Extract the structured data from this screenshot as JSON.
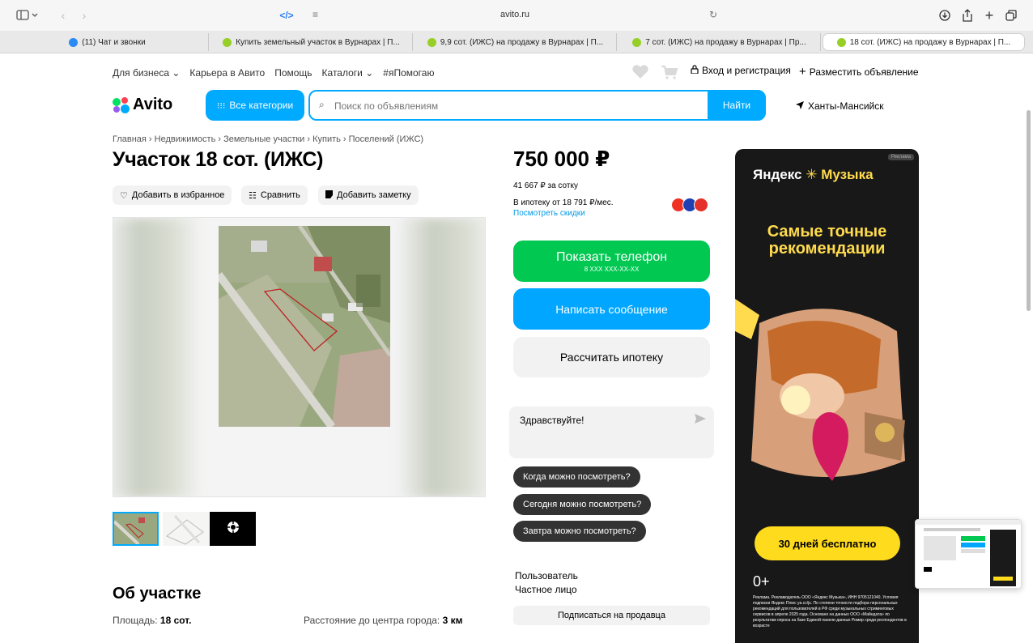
{
  "browser": {
    "url": "avito.ru",
    "tabs": [
      {
        "title": "(11) Чат и звонки",
        "color": "#2a8af6"
      },
      {
        "title": "Купить земельный участок в Вурнарах | П...",
        "color": "#97cf26"
      },
      {
        "title": "9,9 сот. (ИЖС) на продажу в Вурнарах | П...",
        "color": "#97cf26"
      },
      {
        "title": "7 сот. (ИЖС) на продажу в Вурнарах | Пр...",
        "color": "#97cf26"
      },
      {
        "title": "18 сот. (ИЖС) на продажу в Вурнарах | П...",
        "color": "#97cf26"
      }
    ]
  },
  "topnav": {
    "items": [
      "Для бизнеса ⌄",
      "Карьера в Авито",
      "Помощь",
      "Каталоги ⌄",
      "#яПомогаю"
    ],
    "login": "Вход и регистрация",
    "post_ad": "Разместить объявление"
  },
  "header": {
    "logo": "Avito",
    "categories_button": "Все категории",
    "search_placeholder": "Поиск по объявлениям",
    "find_button": "Найти",
    "city": "Ханты-Мансийск"
  },
  "breadcrumbs": "Главная › Недвижимость › Земельные участки › Купить › Поселений (ИЖС)",
  "listing": {
    "title": "Участок 18 сот. (ИЖС)",
    "actions": {
      "favorite": "Добавить в избранное",
      "compare": "Сравнить",
      "note": "Добавить заметку"
    },
    "about_heading": "Об участке",
    "params": [
      {
        "label": "Площадь:",
        "value": "18 сот."
      },
      {
        "label": "Расстояние до центра города:",
        "value": "3 км"
      }
    ]
  },
  "sidebar": {
    "price": "750 000 ₽",
    "per_sotka": "41 667 ₽ за сотку",
    "mortgage": "В ипотеку от 18 791 ₽/мес.",
    "discounts_link": "Посмотреть скидки",
    "show_phone": "Показать телефон",
    "phone_mask": "8 XXX XXX-XX-XX",
    "write_message": "Написать сообщение",
    "calc_mortgage": "Рассчитать ипотеку",
    "chat_greeting": "Здравствуйте!",
    "quick_replies": [
      "Когда можно посмотреть?",
      "Сегодня можно посмотреть?",
      "Завтра можно посмотреть?"
    ],
    "seller_name": "Пользователь",
    "seller_type": "Частное лицо",
    "subscribe": "Подписаться на продавца"
  },
  "ad": {
    "mark": "Реклама",
    "brand_left": "Яндекс",
    "brand_right": "Музыка",
    "headline": "Самые точные рекомендации",
    "cta": "30 дней бесплатно",
    "age": "0+",
    "legal": "Реклама. Рекламодатель ООО «Яндекс Музыка», ИНН 9705121040. Условия подписки Яндекс Плюс ya.cc/js. По степени точности подбора персональных рекомендаций для пользователей в РФ среди музыкальных стриминговых сервисов в апреле 2025 года. Основано на данных ООО «Майндата» по результатам опроса на базе Единой панели данных Ромир среди респондентов в возрасте"
  },
  "colors": {
    "accent": "#00aaff",
    "green": "#00c851",
    "ad_yellow": "#ffdb1d"
  }
}
